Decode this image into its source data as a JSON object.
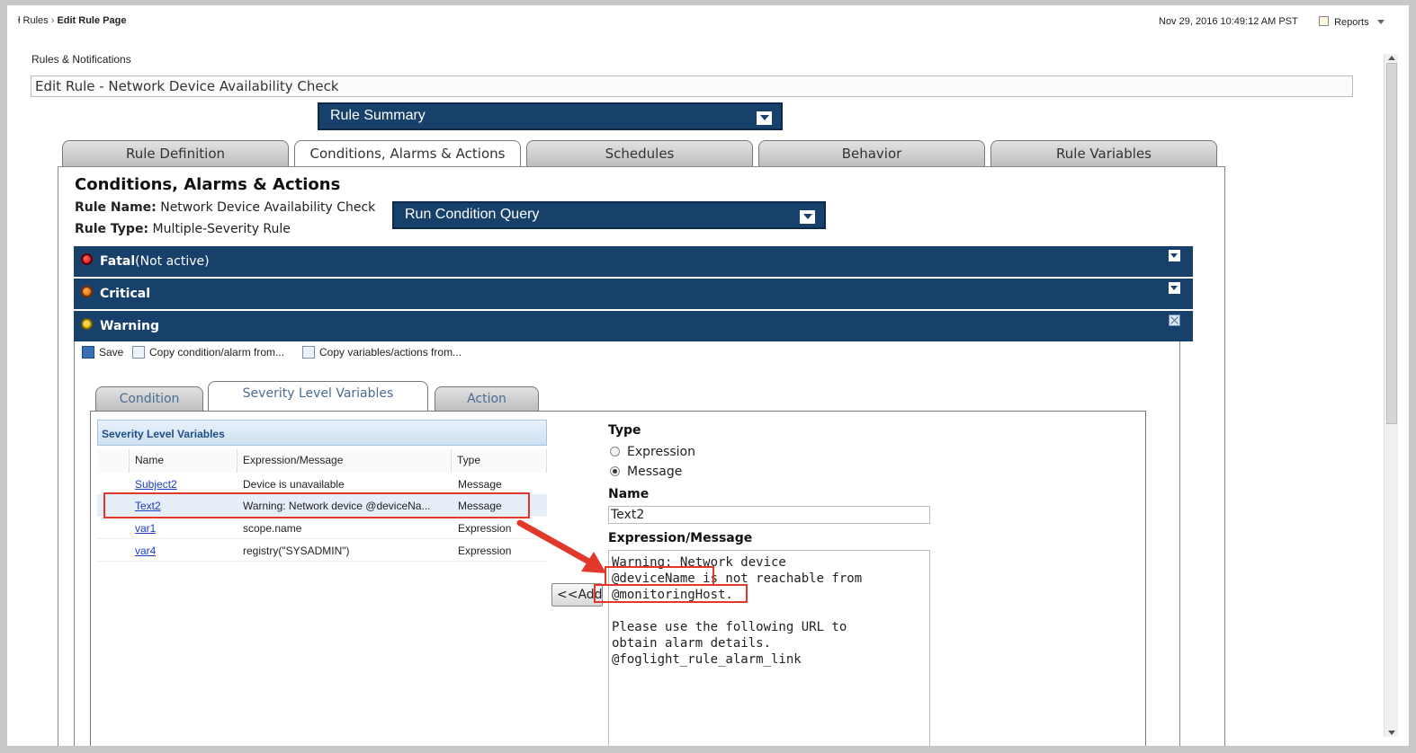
{
  "breadcrumb": {
    "root": "Rules",
    "current": "Edit Rule Page"
  },
  "header": {
    "datetime": "Nov 29, 2016 10:49:12 AM PST",
    "reports_label": "Reports"
  },
  "section_title": "Rules & Notifications",
  "rule_title": "Edit Rule - Network Device Availability Check",
  "rule_summary_label": "Rule Summary",
  "tabs": [
    {
      "label": "Rule Definition"
    },
    {
      "label": "Conditions, Alarms & Actions"
    },
    {
      "label": "Schedules"
    },
    {
      "label": "Behavior"
    },
    {
      "label": "Rule Variables"
    }
  ],
  "conditions": {
    "heading": "Conditions, Alarms & Actions",
    "rule_name_label": "Rule Name:",
    "rule_name_value": "Network Device Availability Check",
    "rule_type_label": "Rule Type:",
    "rule_type_value": "Multiple-Severity Rule",
    "run_query_label": "Run Condition Query"
  },
  "severities": [
    {
      "name": "Fatal",
      "note": "(Not active)",
      "color": "#e01010"
    },
    {
      "name": "Critical",
      "note": "",
      "color": "#f07a1a"
    },
    {
      "name": "Warning",
      "note": "",
      "color": "#f2c200"
    }
  ],
  "toolbar": {
    "save": "Save",
    "copy_condition": "Copy condition/alarm from...",
    "copy_variables": "Copy variables/actions from..."
  },
  "subtabs": [
    {
      "label": "Condition"
    },
    {
      "label": "Severity Level Variables"
    },
    {
      "label": "Action"
    }
  ],
  "variables_table": {
    "title": "Severity Level Variables",
    "columns": [
      "Name",
      "Expression/Message",
      "Type"
    ],
    "rows": [
      {
        "name": "Subject2",
        "expr": "Device is unavailable",
        "type": "Message"
      },
      {
        "name": "Text2",
        "expr": "Warning: Network device @deviceNa...",
        "type": "Message"
      },
      {
        "name": "var1",
        "expr": "scope.name",
        "type": "Expression"
      },
      {
        "name": "var4",
        "expr": "registry(\"SYSADMIN\")",
        "type": "Expression"
      }
    ]
  },
  "add_button": "<<Add",
  "editor": {
    "type_label": "Type",
    "type_options": [
      "Expression",
      "Message"
    ],
    "type_selected": "Message",
    "name_label": "Name",
    "name_value": "Text2",
    "expr_label": "Expression/Message",
    "expr_value": "Warning: Network device\n@deviceName is not reachable from\n@monitoringHost.\n\nPlease use the following URL to\nobtain alarm details.\n@foglight_rule_alarm_link"
  },
  "colors": {
    "navy": "#17406b",
    "annotation_red": "#e2382b",
    "link": "#1a3dc4"
  }
}
